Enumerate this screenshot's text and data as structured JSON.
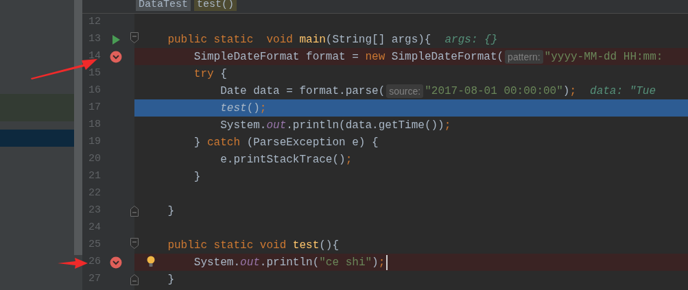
{
  "breadcrumbs": [
    {
      "label": "DataTest",
      "kind": "class"
    },
    {
      "label": "test()",
      "kind": "method"
    }
  ],
  "lines": [
    {
      "number": "12",
      "kind": "plain"
    },
    {
      "number": "13",
      "kind": "plain",
      "runnable": true,
      "fold_start": true,
      "tokens": [
        {
          "text": "    public static  void ",
          "kind": "keyword"
        },
        {
          "text": "main",
          "kind": "method"
        },
        {
          "text": "(String[] args){",
          "kind": "plain"
        },
        {
          "text": "args: {}",
          "kind": "value"
        }
      ]
    },
    {
      "number": "14",
      "kind": "breakpoint",
      "breakpoint": true,
      "tokens": [
        {
          "text": "        SimpleDateFormat format = ",
          "kind": "plain"
        },
        {
          "text": "new",
          "kind": "keyword"
        },
        {
          "text": " SimpleDateFormat(",
          "kind": "plain"
        },
        {
          "text": "pattern:",
          "kind": "hint"
        },
        {
          "text": "\"yyyy-MM-dd HH:mm:",
          "kind": "string"
        }
      ]
    },
    {
      "number": "15",
      "kind": "plain",
      "tokens": [
        {
          "text": "        try",
          "kind": "keyword"
        },
        {
          "text": " {",
          "kind": "plain"
        }
      ]
    },
    {
      "number": "16",
      "kind": "plain",
      "tokens": [
        {
          "text": "            Date data = format.parse(",
          "kind": "plain"
        },
        {
          "text": "source:",
          "kind": "hint"
        },
        {
          "text": "\"2017-08-01 00:00:00\"",
          "kind": "string"
        },
        {
          "text": ")",
          "kind": "plain"
        },
        {
          "text": ";",
          "kind": "keyword"
        },
        {
          "text": "data: \"Tue",
          "kind": "value"
        }
      ]
    },
    {
      "number": "17",
      "kind": "current",
      "tokens": [
        {
          "text": "            test",
          "kind": "call"
        },
        {
          "text": "()",
          "kind": "plain"
        },
        {
          "text": ";",
          "kind": "keyword"
        }
      ]
    },
    {
      "number": "18",
      "kind": "plain",
      "tokens": [
        {
          "text": "            System.",
          "kind": "plain"
        },
        {
          "text": "out",
          "kind": "field"
        },
        {
          "text": ".println(data.getTime())",
          "kind": "plain"
        },
        {
          "text": ";",
          "kind": "keyword"
        }
      ]
    },
    {
      "number": "19",
      "kind": "plain",
      "tokens": [
        {
          "text": "        } ",
          "kind": "plain"
        },
        {
          "text": "catch",
          "kind": "keyword"
        },
        {
          "text": " (ParseException e) {",
          "kind": "plain"
        }
      ]
    },
    {
      "number": "20",
      "kind": "plain",
      "tokens": [
        {
          "text": "            e.printStackTrace()",
          "kind": "plain"
        },
        {
          "text": ";",
          "kind": "keyword"
        }
      ]
    },
    {
      "number": "21",
      "kind": "plain",
      "tokens": [
        {
          "text": "        }",
          "kind": "plain"
        }
      ]
    },
    {
      "number": "22",
      "kind": "plain"
    },
    {
      "number": "23",
      "kind": "plain",
      "fold_end": true,
      "tokens": [
        {
          "text": "    }",
          "kind": "plain"
        }
      ]
    },
    {
      "number": "24",
      "kind": "plain"
    },
    {
      "number": "25",
      "kind": "plain",
      "fold_start": true,
      "tokens": [
        {
          "text": "    public static void ",
          "kind": "keyword"
        },
        {
          "text": "test",
          "kind": "method"
        },
        {
          "text": "(){",
          "kind": "plain"
        }
      ]
    },
    {
      "number": "26",
      "kind": "breakpoint",
      "breakpoint": true,
      "bulb": true,
      "caret": true,
      "tokens": [
        {
          "text": "        System.",
          "kind": "plain"
        },
        {
          "text": "out",
          "kind": "field"
        },
        {
          "text": ".println(",
          "kind": "plain"
        },
        {
          "text": "\"ce shi\"",
          "kind": "string"
        },
        {
          "text": ")",
          "kind": "plain"
        },
        {
          "text": ";",
          "kind": "keyword"
        }
      ]
    },
    {
      "number": "27",
      "kind": "plain",
      "fold_end": true,
      "tokens": [
        {
          "text": "    }",
          "kind": "plain"
        }
      ]
    }
  ]
}
